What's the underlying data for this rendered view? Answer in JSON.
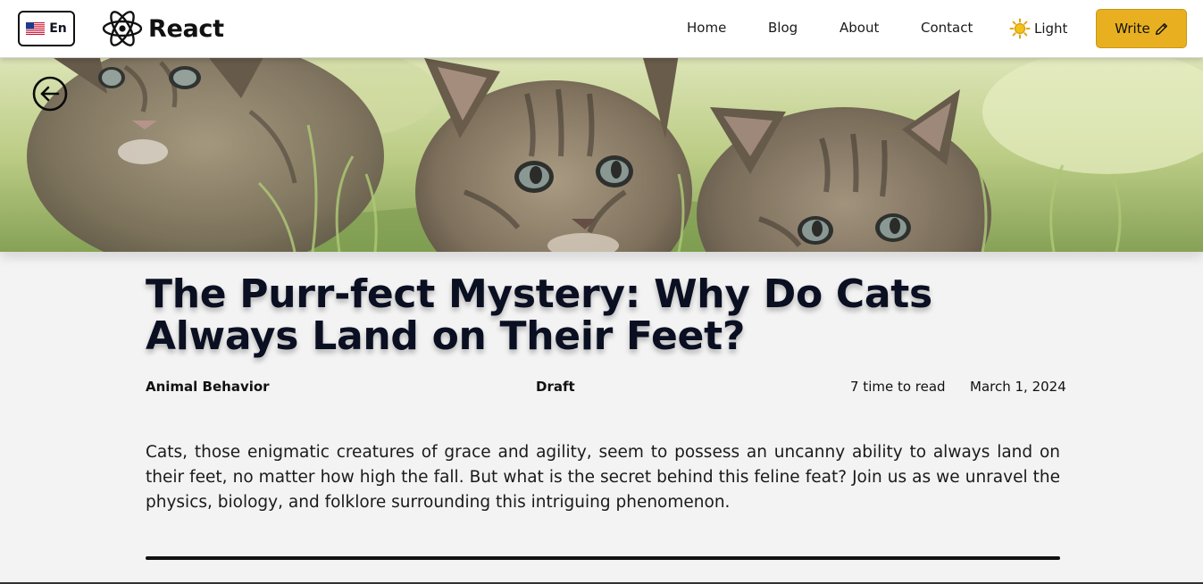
{
  "colors": {
    "accent": "#e8b020",
    "header_bg": "#ffffff",
    "page_bg": "#f3f3f3",
    "text": "#0f1222"
  },
  "header": {
    "language": {
      "label": "En",
      "flag_icon": "us-flag-icon"
    },
    "logo": {
      "text": "React",
      "icon": "react-atom-icon"
    },
    "nav": [
      {
        "label": "Home"
      },
      {
        "label": "Blog"
      },
      {
        "label": "About"
      },
      {
        "label": "Contact"
      }
    ],
    "theme_toggle": {
      "label": "Light",
      "icon": "sun-icon"
    },
    "write_button": {
      "label": "Write",
      "icon": "pencil-icon"
    }
  },
  "hero": {
    "back_icon": "arrow-left-circle-icon"
  },
  "article": {
    "title": "The Purr-fect Mystery: Why Do Cats Always Land on Their Feet?",
    "category": "Animal Behavior",
    "status": "Draft",
    "read_time": "7 time to read",
    "date": "March 1, 2024",
    "intro": "Cats, those enigmatic creatures of grace and agility, seem to possess an uncanny ability to always land on their feet, no matter how high the fall. But what is the secret behind this feline feat? Join us as we unravel the physics, biology, and folklore surrounding this intriguing phenomenon."
  }
}
